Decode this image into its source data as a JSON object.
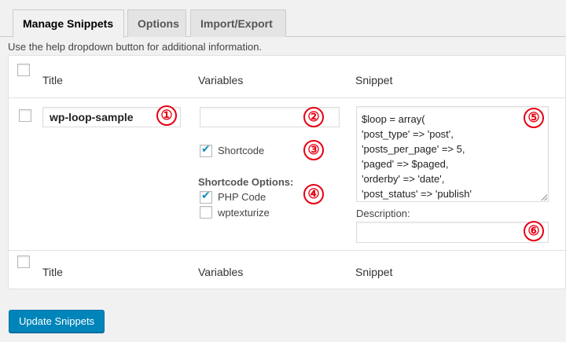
{
  "tabs": [
    {
      "label": "Manage Snippets",
      "active": true
    },
    {
      "label": "Options",
      "active": false
    },
    {
      "label": "Import/Export",
      "active": false
    }
  ],
  "help_text": "Use the help dropdown button for additional information.",
  "columns": {
    "title": "Title",
    "variables": "Variables",
    "snippet": "Snippet"
  },
  "snippet_row": {
    "title_value": "wp-loop-sample",
    "variables_value": "",
    "shortcode_label": "Shortcode",
    "shortcode_checked": true,
    "shortcode_options_label": "Shortcode Options:",
    "php_code_label": "PHP Code",
    "php_code_checked": true,
    "wptexturize_label": "wptexturize",
    "wptexturize_checked": false,
    "snippet_lines": [
      "$loop = array(",
      "'post_type' => 'post',",
      "'posts_per_page' => 5,",
      "'paged' => $paged,",
      "'orderby' => 'date',",
      "'post_status' => 'publish'"
    ],
    "description_label": "Description:",
    "description_value": ""
  },
  "markers": [
    "①",
    "②",
    "③",
    "④",
    "⑤",
    "⑥"
  ],
  "update_button": "Update Snippets",
  "colors": {
    "accent": "#0085ba",
    "marker": "#e60012"
  }
}
